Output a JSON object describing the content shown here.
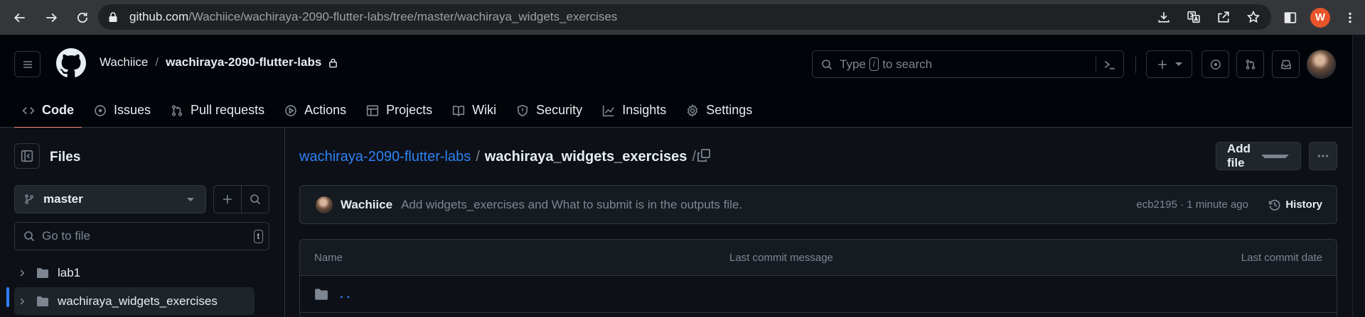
{
  "browser": {
    "url_host": "github.com",
    "url_path": "/Wachiice/wachiraya-2090-flutter-labs/tree/master/wachiraya_widgets_exercises",
    "profile_initial": "W"
  },
  "header": {
    "owner": "Wachiice",
    "separator": "/",
    "repo": "wachiraya-2090-flutter-labs",
    "search_prefix": "Type",
    "search_key": "/",
    "search_suffix": "to search"
  },
  "repo_nav": [
    {
      "label": "Code",
      "icon": "code-icon",
      "active": true
    },
    {
      "label": "Issues",
      "icon": "issue-icon"
    },
    {
      "label": "Pull requests",
      "icon": "pull-request-icon"
    },
    {
      "label": "Actions",
      "icon": "play-icon"
    },
    {
      "label": "Projects",
      "icon": "table-icon"
    },
    {
      "label": "Wiki",
      "icon": "book-icon"
    },
    {
      "label": "Security",
      "icon": "shield-icon"
    },
    {
      "label": "Insights",
      "icon": "graph-icon"
    },
    {
      "label": "Settings",
      "icon": "gear-icon"
    }
  ],
  "sidebar": {
    "title": "Files",
    "branch": "master",
    "goto_placeholder": "Go to file",
    "goto_key": "t",
    "tree": [
      {
        "label": "lab1",
        "selected": false
      },
      {
        "label": "wachiraya_widgets_exercises",
        "selected": true
      }
    ]
  },
  "main": {
    "breadcrumb_repo": "wachiraya-2090-flutter-labs",
    "breadcrumb_sep": "/",
    "breadcrumb_folder": "wachiraya_widgets_exercises",
    "breadcrumb_trail": "/",
    "add_file_label": "Add file",
    "commit": {
      "author": "Wachiice",
      "message": "Add widgets_exercises and What to submit is in the outputs file.",
      "meta": "ecb2195 · 1 minute ago",
      "history_label": "History"
    },
    "table": {
      "col_name": "Name",
      "col_message": "Last commit message",
      "col_date": "Last commit date",
      "parent_link": ". ."
    }
  },
  "colors": {
    "accent_link": "#2f81f7",
    "active_tab_underline": "#fd8c73",
    "profile_badge": "#e8542a"
  }
}
